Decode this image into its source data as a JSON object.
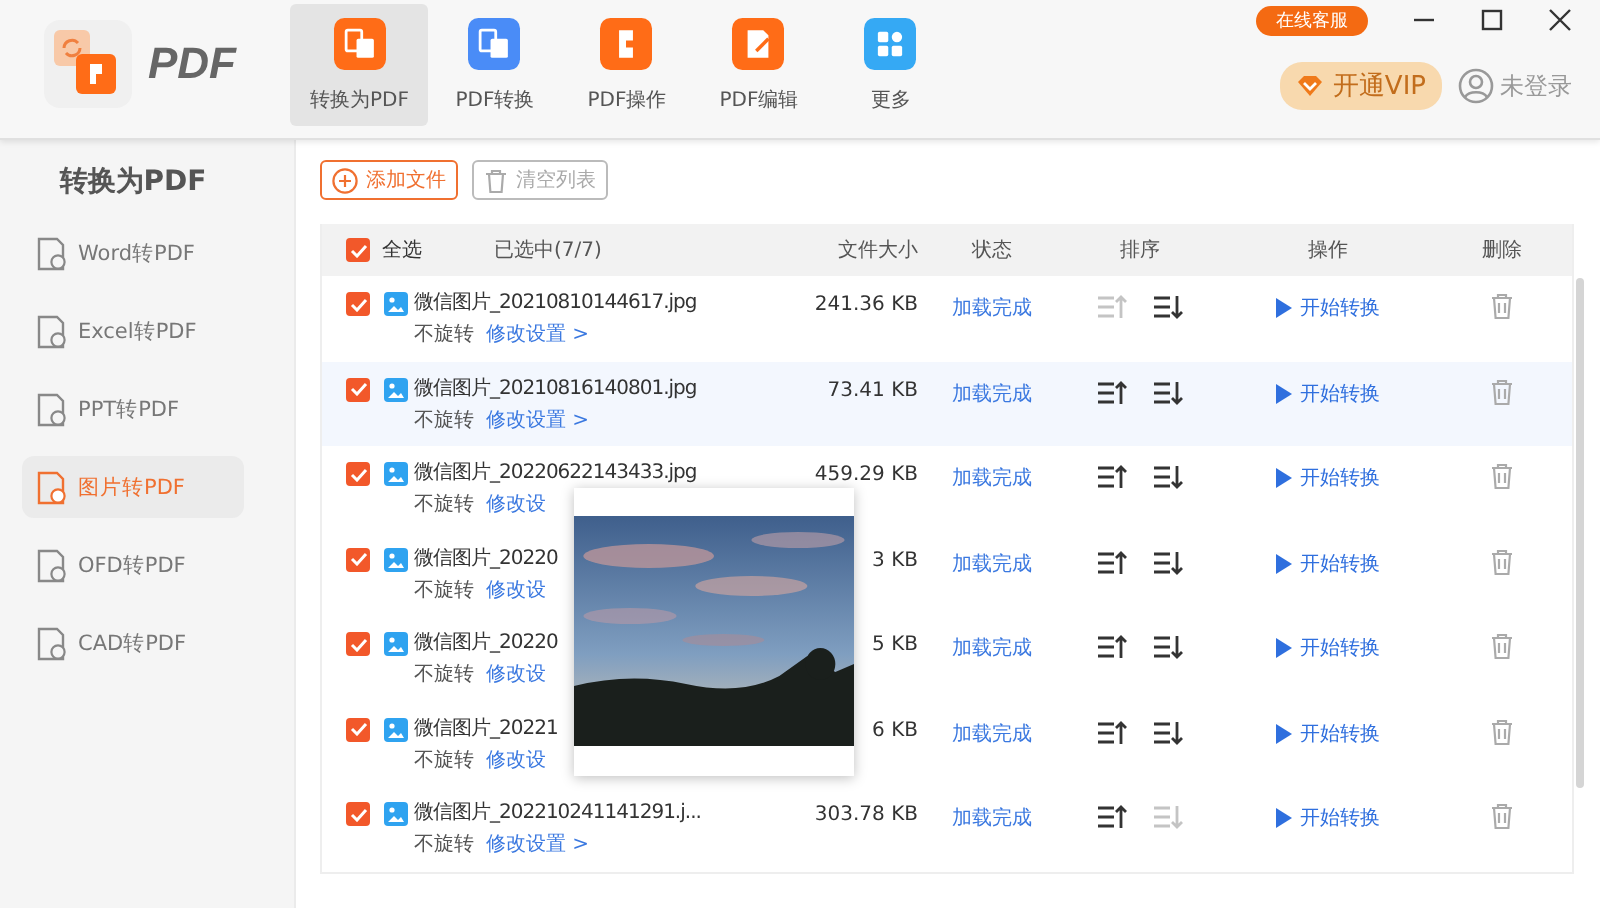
{
  "app": {
    "logo_text": "PDF"
  },
  "toolbar": [
    {
      "label": "转换为PDF",
      "selected": true,
      "color": "#ff6c17",
      "kind": "convert"
    },
    {
      "label": "PDF转换",
      "selected": false,
      "color": "#4a8cf7",
      "kind": "pdf"
    },
    {
      "label": "PDF操作",
      "selected": false,
      "color": "#ff6c17",
      "kind": "puzzle"
    },
    {
      "label": "PDF编辑",
      "selected": false,
      "color": "#ff6c17",
      "kind": "edit"
    },
    {
      "label": "更多",
      "selected": false,
      "color": "#35a9f4",
      "kind": "grid"
    }
  ],
  "top_right": {
    "service_button": "在线客服",
    "vip_button": "开通VIP",
    "login": "未登录"
  },
  "sidebar": {
    "title": "转换为PDF",
    "items": [
      {
        "label": "Word转PDF",
        "selected": false
      },
      {
        "label": "Excel转PDF",
        "selected": false
      },
      {
        "label": "PPT转PDF",
        "selected": false
      },
      {
        "label": "图片转PDF",
        "selected": true
      },
      {
        "label": "OFD转PDF",
        "selected": false
      },
      {
        "label": "CAD转PDF",
        "selected": false
      }
    ]
  },
  "actions": {
    "add": "添加文件",
    "clear": "清空列表"
  },
  "table": {
    "select_all": {
      "label": "全选",
      "checked": true
    },
    "selected_count": "已选中(7/7)",
    "columns": [
      "文件大小",
      "状态",
      "排序",
      "操作",
      "删除"
    ],
    "rows": [
      {
        "checked": true,
        "selected": false,
        "name": "微信图片_20210810144617.jpg",
        "rotation": "不旋转",
        "settings": "修改设置 >",
        "size": "241.36 KB",
        "status": "加载完成",
        "up_enabled": false,
        "down_enabled": true,
        "action": "开始转换"
      },
      {
        "checked": true,
        "selected": true,
        "name": "微信图片_20210816140801.jpg",
        "rotation": "不旋转",
        "settings": "修改设置 >",
        "size": "73.41 KB",
        "status": "加载完成",
        "up_enabled": true,
        "down_enabled": true,
        "action": "开始转换"
      },
      {
        "checked": true,
        "selected": false,
        "name": "微信图片_20220622143433.jpg",
        "rotation": "不旋转",
        "settings": "修改设",
        "size": "459.29 KB",
        "status": "加载完成",
        "up_enabled": true,
        "down_enabled": true,
        "action": "开始转换"
      },
      {
        "checked": true,
        "selected": false,
        "name": "微信图片_20220",
        "rotation": "不旋转",
        "settings": "修改设",
        "size": "3 KB",
        "status": "加载完成",
        "up_enabled": true,
        "down_enabled": true,
        "action": "开始转换"
      },
      {
        "checked": true,
        "selected": false,
        "name": "微信图片_20220",
        "rotation": "不旋转",
        "settings": "修改设",
        "size": "5 KB",
        "status": "加载完成",
        "up_enabled": true,
        "down_enabled": true,
        "action": "开始转换"
      },
      {
        "checked": true,
        "selected": false,
        "name": "微信图片_20221",
        "rotation": "不旋转",
        "settings": "修改设",
        "size": "6 KB",
        "status": "加载完成",
        "up_enabled": true,
        "down_enabled": true,
        "action": "开始转换"
      },
      {
        "checked": true,
        "selected": false,
        "name": "微信图片_202210241141291.j...",
        "rotation": "不旋转",
        "settings": "修改设置 >",
        "size": "303.78 KB",
        "status": "加载完成",
        "up_enabled": true,
        "down_enabled": false,
        "action": "开始转换"
      }
    ]
  },
  "preview": {
    "open": true,
    "kind": "picture"
  }
}
